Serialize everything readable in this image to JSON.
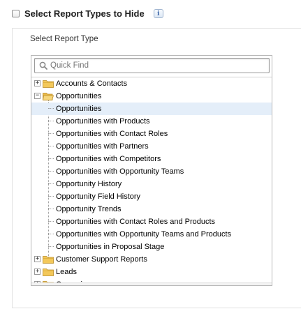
{
  "header": {
    "checkbox_checked": false,
    "label": "Select Report Types to Hide",
    "info_icon": "i"
  },
  "panel": {
    "label": "Select Report Type",
    "search": {
      "placeholder": "Quick Find",
      "value": ""
    },
    "tree": [
      {
        "label": "Accounts & Contacts",
        "type": "category",
        "expanded": false
      },
      {
        "label": "Opportunities",
        "type": "category",
        "expanded": true
      },
      {
        "label": "Opportunities",
        "type": "leaf",
        "selected": true
      },
      {
        "label": "Opportunities with Products",
        "type": "leaf"
      },
      {
        "label": "Opportunities with Contact Roles",
        "type": "leaf"
      },
      {
        "label": "Opportunities with Partners",
        "type": "leaf"
      },
      {
        "label": "Opportunities with Competitors",
        "type": "leaf"
      },
      {
        "label": "Opportunities with Opportunity Teams",
        "type": "leaf"
      },
      {
        "label": "Opportunity History",
        "type": "leaf"
      },
      {
        "label": "Opportunity Field History",
        "type": "leaf"
      },
      {
        "label": "Opportunity Trends",
        "type": "leaf"
      },
      {
        "label": "Opportunities with Contact Roles and Products",
        "type": "leaf"
      },
      {
        "label": "Opportunities with Opportunity Teams and Products",
        "type": "leaf"
      },
      {
        "label": "Opportunities in Proposal Stage",
        "type": "leaf"
      },
      {
        "label": "Customer Support Reports",
        "type": "category",
        "expanded": false
      },
      {
        "label": "Leads",
        "type": "category",
        "expanded": false
      },
      {
        "label": "Campaigns",
        "type": "category",
        "expanded": false
      }
    ]
  },
  "colors": {
    "selected_row": "#e4eef9",
    "folder": "#f3c85a"
  }
}
